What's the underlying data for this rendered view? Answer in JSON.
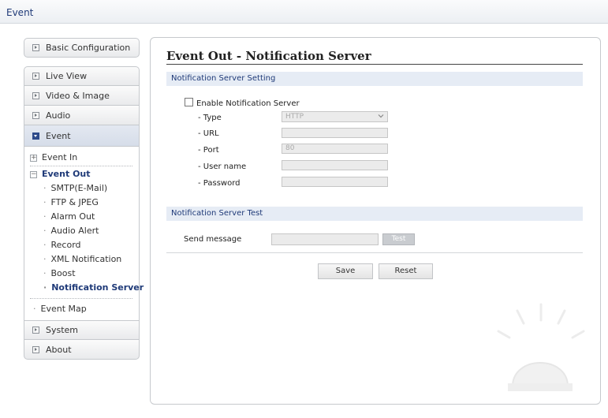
{
  "breadcrumb": "Event",
  "sidebar": {
    "items": [
      {
        "label": "Basic Configuration"
      },
      {
        "label": "Live View"
      },
      {
        "label": "Video & Image"
      },
      {
        "label": "Audio"
      },
      {
        "label": "Event"
      },
      {
        "label": "System"
      },
      {
        "label": "About"
      }
    ],
    "event_sub": {
      "event_in": "Event In",
      "event_out": "Event Out",
      "event_out_items": [
        "SMTP(E-Mail)",
        "FTP & JPEG",
        "Alarm Out",
        "Audio Alert",
        "Record",
        "XML Notification",
        "Boost",
        "Notification Server"
      ],
      "event_map": "Event Map"
    }
  },
  "main": {
    "title": "Event Out - Notification Server",
    "setting_section": "Notification Server Setting",
    "enable_label": "Enable Notification Server",
    "fields": {
      "type_label": "- Type",
      "type_value": "HTTP",
      "url_label": "- URL",
      "url_value": "",
      "port_label": "- Port",
      "port_value": "80",
      "username_label": "- User name",
      "username_value": "",
      "password_label": "- Password",
      "password_value": ""
    },
    "test_section": "Notification Server Test",
    "send_label": "Send message",
    "send_value": "",
    "test_button": "Test",
    "save_button": "Save",
    "reset_button": "Reset"
  },
  "colors": {
    "accent": "#1f3a78",
    "section_bg": "#e6ecf5"
  }
}
